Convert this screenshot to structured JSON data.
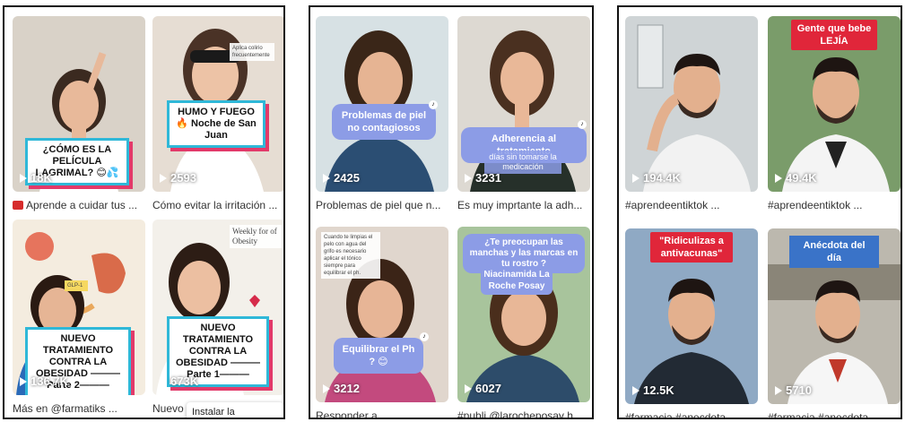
{
  "panels": [
    {
      "videos": [
        {
          "views": "18K",
          "caption": "Aprende a cuidar tus ...",
          "warning": true,
          "overlay": "¿CÓMO ES LA PELÍCULA LAGRIMAL? 😊💦",
          "bg": "#d9d2c8",
          "shirt": "#ffffff",
          "hair": "#3b2a20"
        },
        {
          "views": "2593",
          "caption": "Cómo evitar la irritación ...",
          "overlay": "HUMO Y FUEGO 🔥 Noche de San Juan",
          "overlay_small": "Aplica colirio frecuentemente",
          "bg": "#e6ddd3",
          "shirt": "#ffffff",
          "hair": "#4a3226"
        },
        {
          "views": "136.7K",
          "caption": "Más en @farmatiks ...",
          "overlay": "NUEVO TRATAMIENTO CONTRA LA OBESIDAD ———Parte 2———",
          "overlay_small": "GLP-1",
          "bg": "#f4ecdf",
          "shirt": "#2a6ab8",
          "hair": "#2a1a12"
        },
        {
          "views": "673K",
          "caption": "Nuevo",
          "overlay": "NUEVO TRATAMIENTO CONTRA LA OBESIDAD ———Parte 1———",
          "overlay_small": "Weekly for of Obesity",
          "bg": "#f3f0ea",
          "shirt": "#ffffff",
          "hair": "#2d1d15"
        }
      ],
      "install_label": "Instalar la aplicación"
    },
    {
      "videos": [
        {
          "views": "2425",
          "caption": "Problemas de piel que n...",
          "overlay": "Problemas de piel no contagiosos",
          "bg": "#d7e1e4",
          "shirt": "#2b4e73",
          "hair": "#3a2618"
        },
        {
          "views": "3231",
          "caption": "Es muy imprtante la adh...",
          "overlay": "Adherencia al tratamiento",
          "overlay_small": "días sin tomarse la medicación",
          "bg": "#ddd9d2",
          "shirt": "#26302a",
          "hair": "#4a3020"
        },
        {
          "views": "3212",
          "caption": "Responder a ...",
          "overlay": "Equilibrar el Ph ? 😊",
          "overlay_small": "Cuando te limpias el pelo con agua del grifo es necesario aplicar el tónico siempre para equilibrar el ph.",
          "bg": "#e0d6cd",
          "shirt": "#c34a7e",
          "hair": "#3b2417"
        },
        {
          "views": "6027",
          "caption": "#publi @larocheposay h...",
          "overlay": "¿Te preocupan las manchas y las marcas en tu rostro ?",
          "overlay_small": "Niacinamida La Roche Posay",
          "bg": "#a8c49c",
          "shirt": "#2d4c6a",
          "hair": "#4a2e1c"
        }
      ]
    },
    {
      "videos": [
        {
          "views": "194.4K",
          "caption": "#aprendeentiktok ...",
          "bg": "#cfd4d6",
          "shirt": "#f2f2f2",
          "hair": "#1e1512"
        },
        {
          "views": "49.4K",
          "caption": "#aprendeentiktok ...",
          "overlay": "Gente que bebe LEJÍA",
          "bg": "#7a9c6a",
          "shirt": "#f4f4f4",
          "hair": "#1e1512"
        },
        {
          "views": "12.5K",
          "caption": "#farmacia #anecdota ...",
          "overlay": "\"Ridiculizas a antivacunas\"",
          "bg": "#8fa9c4",
          "shirt": "#222a34",
          "hair": "#1e1512"
        },
        {
          "views": "5710",
          "caption": "#farmacia #anecdota ...",
          "overlay": "Anécdota del día",
          "bg": "#bcb8ae",
          "shirt": "#f6f6f6",
          "hair": "#1e1512"
        }
      ]
    }
  ]
}
